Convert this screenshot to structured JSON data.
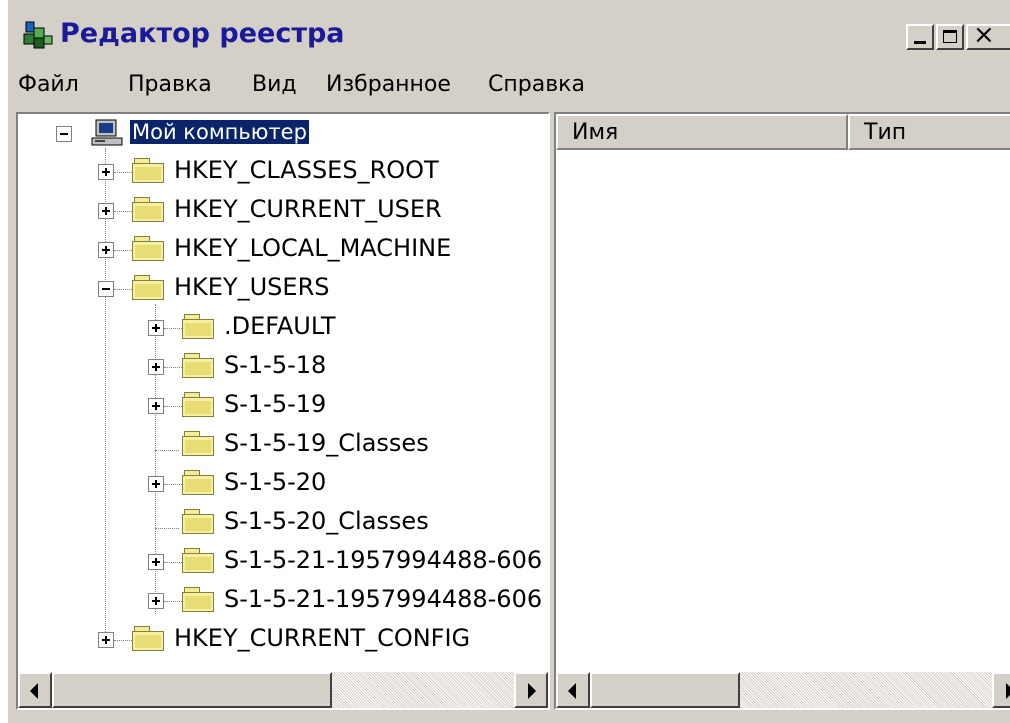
{
  "window": {
    "title": "Редактор реестра",
    "close_glyph": "×"
  },
  "menu": [
    {
      "label": "Файл"
    },
    {
      "label": "Правка"
    },
    {
      "label": "Вид"
    },
    {
      "label": "Избранное"
    },
    {
      "label": "Справка"
    }
  ],
  "tree": {
    "root": "Мой компьютер",
    "hives": [
      {
        "label": "HKEY_CLASSES_ROOT",
        "expander": "plus"
      },
      {
        "label": "HKEY_CURRENT_USER",
        "expander": "plus"
      },
      {
        "label": "HKEY_LOCAL_MACHINE",
        "expander": "plus"
      },
      {
        "label": "HKEY_USERS",
        "expander": "minus"
      },
      {
        "label": "HKEY_CURRENT_CONFIG",
        "expander": "plus"
      }
    ],
    "users_children": [
      {
        "label": ".DEFAULT",
        "expander": "plus"
      },
      {
        "label": "S-1-5-18",
        "expander": "plus"
      },
      {
        "label": "S-1-5-19",
        "expander": "plus"
      },
      {
        "label": "S-1-5-19_Classes",
        "expander": "none"
      },
      {
        "label": "S-1-5-20",
        "expander": "plus"
      },
      {
        "label": "S-1-5-20_Classes",
        "expander": "none"
      },
      {
        "label": "S-1-5-21-1957994488-606",
        "expander": "plus"
      },
      {
        "label": "S-1-5-21-1957994488-606",
        "expander": "plus"
      }
    ]
  },
  "list": {
    "columns": [
      "Имя",
      "Тип"
    ]
  },
  "icons": {
    "app": "registry-editor-icon",
    "computer": "computer-icon",
    "folder": "folder-icon"
  },
  "colors": {
    "window_bg": "#d4d0c8",
    "title_text": "#1a1a9a",
    "selection": "#0a246a",
    "folder": "#f7f0a0"
  }
}
